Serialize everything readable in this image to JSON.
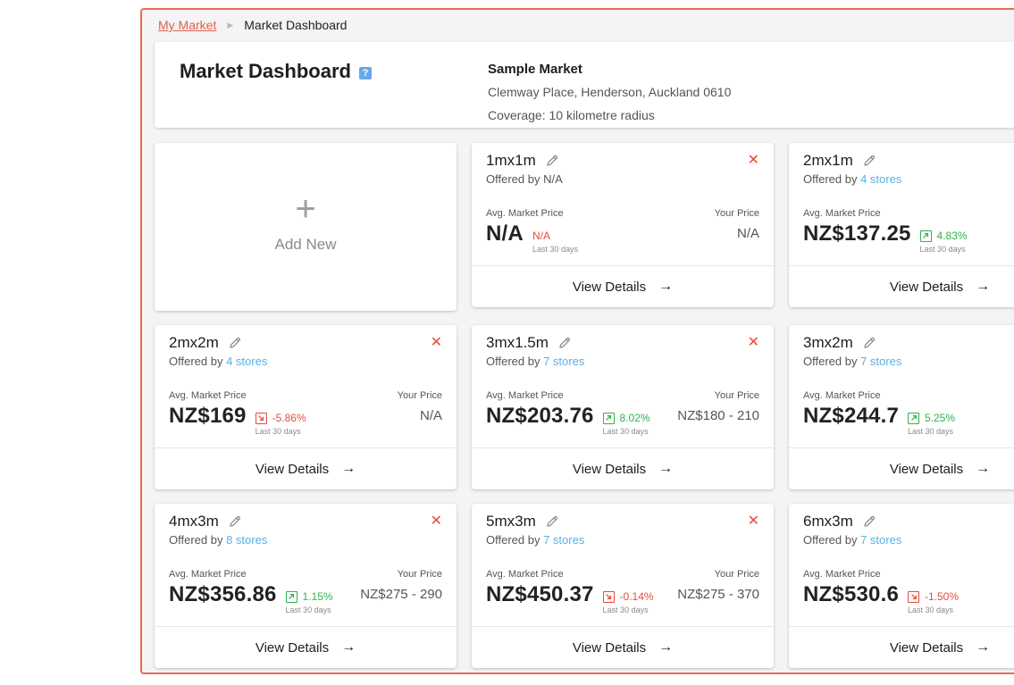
{
  "breadcrumb": {
    "link": "My Market",
    "current": "Market Dashboard"
  },
  "header": {
    "title": "Market Dashboard",
    "help": "?",
    "market_name": "Sample Market",
    "address": "Clemway Place, Henderson, Auckland 0610",
    "coverage": "Coverage: 10 kilometre radius"
  },
  "add_card": {
    "plus": "+",
    "label": "Add New"
  },
  "labels": {
    "offered_by": "Offered by ",
    "avg_market_price": "Avg. Market Price",
    "your_price": "Your Price",
    "last_30_days": "Last 30 days",
    "view_details": "View Details"
  },
  "colors": {
    "accent": "#ea6a55",
    "up": "#2fb34a",
    "down": "#e64b3b",
    "link": "#58b1e3"
  },
  "cards": [
    {
      "size": "1mx1m",
      "removable": true,
      "offered": "N/A",
      "offered_is_link": false,
      "avg_price": "N/A",
      "change": "N/A",
      "direction": "none",
      "your_price": "N/A"
    },
    {
      "size": "2mx1m",
      "removable": false,
      "offered": "4 stores",
      "offered_is_link": true,
      "avg_price": "NZ$137.25",
      "change": "4.83%",
      "direction": "up",
      "your_price": ""
    },
    {
      "size": "2mx2m",
      "removable": true,
      "offered": "4 stores",
      "offered_is_link": true,
      "avg_price": "NZ$169",
      "change": "-5.86%",
      "direction": "down",
      "your_price": "N/A"
    },
    {
      "size": "3mx1.5m",
      "removable": true,
      "offered": "7 stores",
      "offered_is_link": true,
      "avg_price": "NZ$203.76",
      "change": "8.02%",
      "direction": "up",
      "your_price": "NZ$180 - 210"
    },
    {
      "size": "3mx2m",
      "removable": false,
      "offered": "7 stores",
      "offered_is_link": true,
      "avg_price": "NZ$244.7",
      "change": "5.25%",
      "direction": "up",
      "your_price": ""
    },
    {
      "size": "4mx3m",
      "removable": true,
      "offered": "8 stores",
      "offered_is_link": true,
      "avg_price": "NZ$356.86",
      "change": "1.15%",
      "direction": "up",
      "your_price": "NZ$275 - 290"
    },
    {
      "size": "5mx3m",
      "removable": true,
      "offered": "7 stores",
      "offered_is_link": true,
      "avg_price": "NZ$450.37",
      "change": "-0.14%",
      "direction": "down",
      "your_price": "NZ$275 - 370"
    },
    {
      "size": "6mx3m",
      "removable": false,
      "offered": "7 stores",
      "offered_is_link": true,
      "avg_price": "NZ$530.6",
      "change": "-1.50%",
      "direction": "down",
      "your_price": ""
    }
  ]
}
